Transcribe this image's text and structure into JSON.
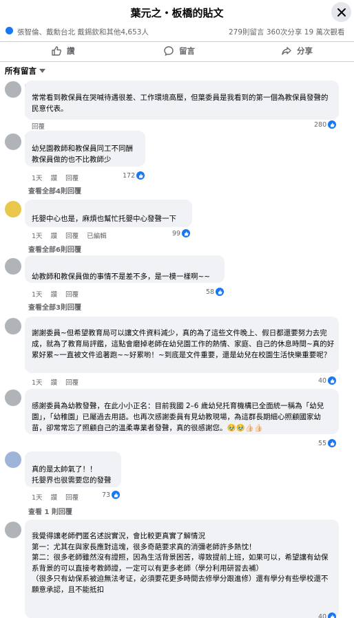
{
  "header": {
    "title": "葉元之・板橋的貼文"
  },
  "stats": {
    "reactors": "張智倫、戴勳台北 戴錫欽和其他4,653人",
    "counts": "279則留言 360次分享 19 萬次觀看"
  },
  "actions": {
    "like": "讚",
    "comment": "留言",
    "share": "分享"
  },
  "filter": {
    "label": "所有留言"
  },
  "comments": [
    {
      "text": "常常看到教保員在哭喊待遇很差、工作環境高壓，但葉委員是我看到的第一個為教保員發聲的民意代表。",
      "time": "",
      "like": "",
      "reply": "回覆",
      "edited": "",
      "reactions": "280",
      "view_replies": ""
    },
    {
      "text": "幼兒園教師和教保員同工不同酬\n教保員做的也不比教師少",
      "time": "1天",
      "like": "讚",
      "reply": "回覆",
      "edited": "",
      "reactions": "172",
      "view_replies": "查看全部4則回覆"
    },
    {
      "text": "托嬰中心也是，麻煩也幫忙托嬰中心發聲一下",
      "time": "1天",
      "like": "讚",
      "reply": "回覆",
      "edited": "已編輯",
      "reactions": "99",
      "view_replies": "查看全部6則回覆"
    },
    {
      "text": "幼教師和教保員做的事情不是差不多，是一模一樣啊~~",
      "time": "1天",
      "like": "讚",
      "reply": "回覆",
      "edited": "",
      "reactions": "58",
      "view_replies": "查看全部3則回覆"
    },
    {
      "text": "謝謝委員~但希望教育局可以讓文件資料減少，真的為了這些文件晚上、假日都還要努力去完成，就為了教育局評鑑，這點會磨掉老師在幼兒園工作的熱情、家庭、自己的休息時間~真的好累好累~一直被文件追著跑~~好累喲！~到底是文件重要，還是幼兒在校園生活快樂重要呢？",
      "time": "1天",
      "like": "讚",
      "reply": "回覆",
      "edited": "",
      "reactions": "40",
      "view_replies": ""
    },
    {
      "text": "感謝委員為幼教發聲，在此小小正名：目前我國 2–6 歲幼兒托育機構已全面統一稱為「幼兒園」，「幼稚園」已屬過去用語。也再次感謝委員有見幼教現場，為這群長期細心照顧國家幼苗，卻常常忘了照顧自己的溫柔專業者發聲，真的很感謝您。🥹🥹👍🏻👍🏻",
      "time": "1天",
      "like": "讚",
      "reply": "回覆",
      "edited": "",
      "reactions": "55",
      "view_replies": ""
    },
    {
      "text": "真的是太帥氣了！！\n托嬰界也很需要您的發聲",
      "time": "1天",
      "like": "讚",
      "reply": "回覆",
      "edited": "",
      "reactions": "73",
      "view_replies": "查看 1 則回覆"
    },
    {
      "text": "我覺得讓老師們匿名述說實況，會比較更真實了解情況\n第一：尤其在與家長應對這塊，很多奇葩要求真的消彌老師許多熱忱！\n第二：很多老師雖然沒有證照，因為生活背景困苦，導致提前上班，如果可以，希望讓有幼保系背景的可以直接考教師證，一定可以有更多老師（學分利用研習去補）\n（很多只有幼保系被迫無法考证，必須要花更多時間去修學分跟進修）還有學分有些學校還不願意承認，且不能抵扣",
      "time": "",
      "like": "",
      "reply": "",
      "edited": "",
      "reactions": "40",
      "view_replies": ""
    }
  ],
  "colors": {
    "accent": "#1877f2",
    "bubble": "#f0f2f5",
    "muted": "#65676b"
  },
  "icons": [
    "close-icon",
    "thumbs-up-icon",
    "comment-icon",
    "share-icon",
    "chevron-down-icon",
    "like-reaction-icon"
  ]
}
